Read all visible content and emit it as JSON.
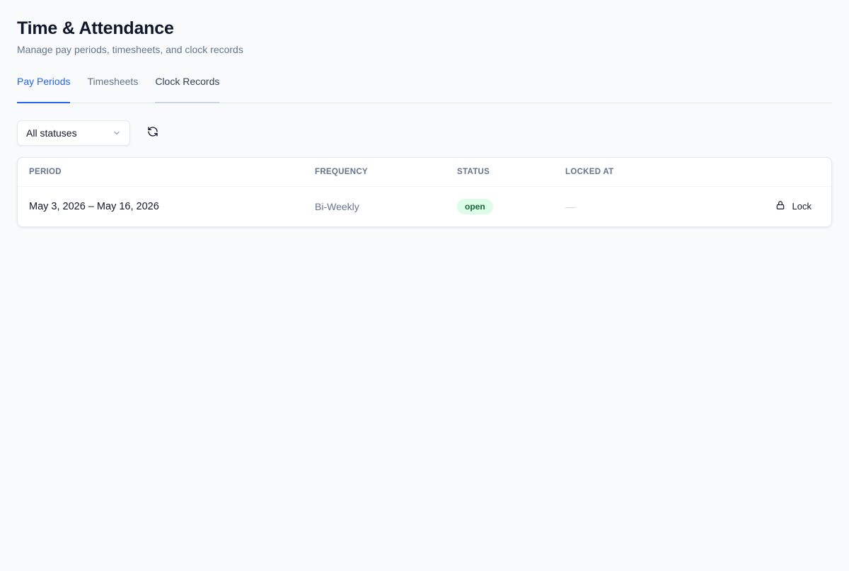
{
  "page": {
    "title": "Time & Attendance",
    "subtitle": "Manage pay periods, timesheets, and clock records"
  },
  "tabs": [
    {
      "label": "Pay Periods",
      "state": "active"
    },
    {
      "label": "Timesheets",
      "state": "default"
    },
    {
      "label": "Clock Records",
      "state": "hover"
    }
  ],
  "toolbar": {
    "status_filter": {
      "selected": "All statuses",
      "icon": "chevron-down-icon"
    },
    "refresh_icon": "refresh-icon"
  },
  "table": {
    "columns": [
      "PERIOD",
      "FREQUENCY",
      "STATUS",
      "LOCKED AT",
      ""
    ],
    "rows": [
      {
        "period": "May 3, 2026 – May 16, 2026",
        "frequency": "Bi-Weekly",
        "status": "open",
        "locked_at": "—",
        "action": {
          "label": "Lock",
          "icon": "lock-icon"
        }
      }
    ]
  },
  "colors": {
    "accent": "#2563eb",
    "status_open_bg": "#dcfce7",
    "status_open_text": "#166534"
  }
}
